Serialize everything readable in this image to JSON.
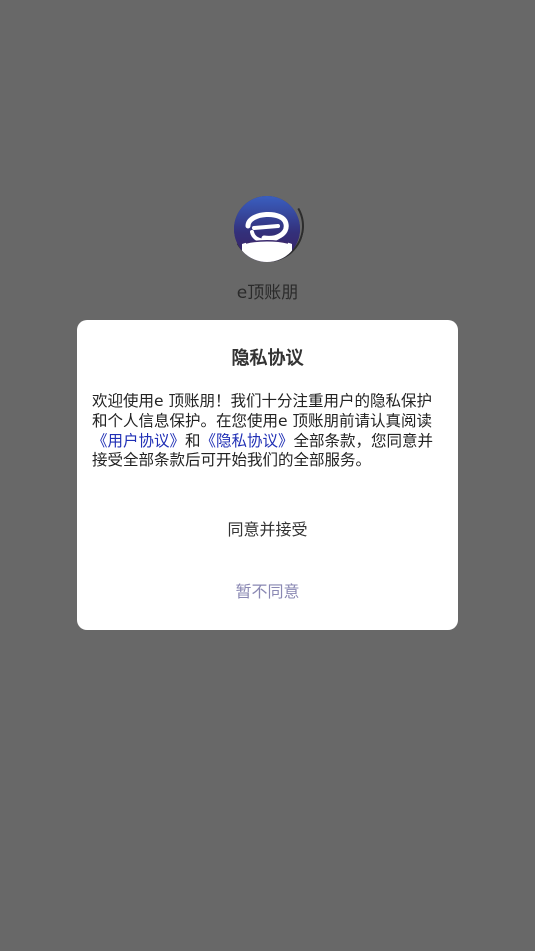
{
  "app": {
    "name": "e顶账朋",
    "logo_text": "e顶账朋"
  },
  "dialog": {
    "title": "隐私协议",
    "body_part1": "欢迎使用e 顶账朋！我们十分注重用户的隐私保护和个人信息保护。在您使用e 顶账朋前请认真阅读 ",
    "user_agreement_link": "《用户协议》",
    "body_and": "和",
    "privacy_policy_link": "《隐私协议》",
    "body_part2": "全部条款，您同意并接受全部条款后可开始我们的全部服务。",
    "agree_label": "同意并接受",
    "disagree_label": "暂不同意"
  },
  "colors": {
    "overlay": "#686868",
    "link": "#1f2fb5",
    "disagree": "#8a88b3",
    "logo_bg": "#2f2f6e"
  },
  "icons": {
    "logo": "app-logo-icon"
  }
}
